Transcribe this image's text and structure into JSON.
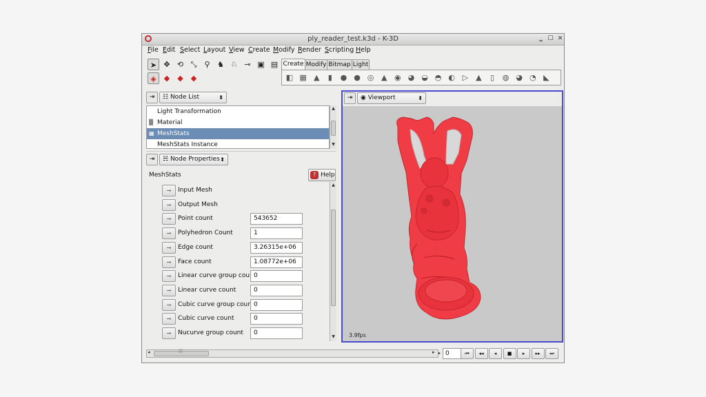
{
  "window": {
    "title": "ply_reader_test.k3d - K-3D",
    "controls": {
      "minimize": "‗",
      "maximize": "☐",
      "close": "✕"
    }
  },
  "menubar": {
    "items": [
      {
        "label": "File",
        "accel": "F"
      },
      {
        "label": "Edit",
        "accel": "E"
      },
      {
        "label": "Select",
        "accel": "S"
      },
      {
        "label": "Layout",
        "accel": "L"
      },
      {
        "label": "View",
        "accel": "V"
      },
      {
        "label": "Create",
        "accel": "C"
      },
      {
        "label": "Modify",
        "accel": "M"
      },
      {
        "label": "Render",
        "accel": "R"
      },
      {
        "label": "Scripting",
        "accel": "S"
      },
      {
        "label": "Help",
        "accel": "H"
      }
    ]
  },
  "toolbar": {
    "row1": [
      {
        "icon": "select-arrow-icon",
        "glyph": "➤"
      },
      {
        "icon": "move-icon",
        "glyph": "✥"
      },
      {
        "icon": "rotate-icon",
        "glyph": "⟲"
      },
      {
        "icon": "scale-icon",
        "glyph": "⤡"
      },
      {
        "icon": "snap-icon",
        "glyph": "⚲"
      },
      {
        "icon": "parent-icon",
        "glyph": "♞"
      },
      {
        "icon": "unparent-icon",
        "glyph": "♘"
      },
      {
        "icon": "plug-icon",
        "glyph": "⊸"
      },
      {
        "icon": "render-frame-icon",
        "glyph": "▣"
      },
      {
        "icon": "render-animation-icon",
        "glyph": "▤"
      }
    ],
    "row2": [
      {
        "icon": "select-nodes-icon",
        "glyph": "◈"
      },
      {
        "icon": "select-points-icon",
        "glyph": "◆"
      },
      {
        "icon": "select-edges-icon",
        "glyph": "◆"
      },
      {
        "icon": "select-faces-icon",
        "glyph": "◆"
      }
    ]
  },
  "create_tabs": {
    "tabs": [
      "Create",
      "Modify",
      "Bitmap",
      "Light"
    ],
    "selected": "Create",
    "icons": [
      {
        "name": "cube-icon",
        "glyph": "◧"
      },
      {
        "name": "grid-icon",
        "glyph": "▦"
      },
      {
        "name": "cone-icon",
        "glyph": "▲"
      },
      {
        "name": "cylinder-icon",
        "glyph": "▮"
      },
      {
        "name": "sphere-icon",
        "glyph": "●"
      },
      {
        "name": "sphere-dark-icon",
        "glyph": "●"
      },
      {
        "name": "torus-icon",
        "glyph": "◎"
      },
      {
        "name": "nurbs-cone-icon",
        "glyph": "▲"
      },
      {
        "name": "nurbs-disk-icon",
        "glyph": "◉"
      },
      {
        "name": "nurbs-sphere-icon",
        "glyph": "◕"
      },
      {
        "name": "nurbs-hyperboloid-icon",
        "glyph": "◒"
      },
      {
        "name": "nurbs-paraboloid-icon",
        "glyph": "◓"
      },
      {
        "name": "nurbs-patch-icon",
        "glyph": "◐"
      },
      {
        "name": "play-shape-icon",
        "glyph": "▷"
      },
      {
        "name": "quadric-cone-icon",
        "glyph": "▲"
      },
      {
        "name": "quadric-cylinder-icon",
        "glyph": "▯"
      },
      {
        "name": "quadric-disk-icon",
        "glyph": "◍"
      },
      {
        "name": "quadric-sphere-icon",
        "glyph": "◕"
      },
      {
        "name": "quadric-torus-icon",
        "glyph": "◔"
      },
      {
        "name": "quadric-paraboloid-icon",
        "glyph": "◣"
      }
    ]
  },
  "node_list_panel": {
    "combo": "Node List",
    "items": [
      {
        "label": "Light Transformation",
        "icon": ""
      },
      {
        "label": "Material",
        "icon": "▒"
      },
      {
        "label": "MeshStats",
        "icon": "▦",
        "selected": true
      },
      {
        "label": "MeshStats Instance",
        "icon": ""
      }
    ]
  },
  "node_properties_panel": {
    "combo": "Node Properties",
    "node_name": "MeshStats",
    "help_label": "Help",
    "properties": [
      {
        "label": "Input Mesh",
        "value": null
      },
      {
        "label": "Output Mesh",
        "value": null
      },
      {
        "label": "Point count",
        "value": "543652"
      },
      {
        "label": "Polyhedron Count",
        "value": "1"
      },
      {
        "label": "Edge count",
        "value": "3.26315e+06"
      },
      {
        "label": "Face count",
        "value": "1.08772e+06"
      },
      {
        "label": "Linear curve group count",
        "value": "0"
      },
      {
        "label": "Linear curve count",
        "value": "0"
      },
      {
        "label": "Cubic curve group count",
        "value": "0"
      },
      {
        "label": "Cubic curve count",
        "value": "0"
      },
      {
        "label": "Nucurve group count",
        "value": "0"
      }
    ]
  },
  "viewport_panel": {
    "combo": "Viewport",
    "fps": "3.9fps",
    "model_color": "#f03c45"
  },
  "timeline": {
    "frame": "0",
    "buttons": [
      {
        "name": "go-to-start-button",
        "glyph": "⏮"
      },
      {
        "name": "step-back-fast-button",
        "glyph": "◂◂"
      },
      {
        "name": "play-reverse-button",
        "glyph": "◂"
      },
      {
        "name": "stop-button",
        "glyph": "■"
      },
      {
        "name": "play-button",
        "glyph": "▸"
      },
      {
        "name": "step-forward-fast-button",
        "glyph": "▸▸"
      },
      {
        "name": "go-to-end-button",
        "glyph": "⏭"
      }
    ]
  }
}
